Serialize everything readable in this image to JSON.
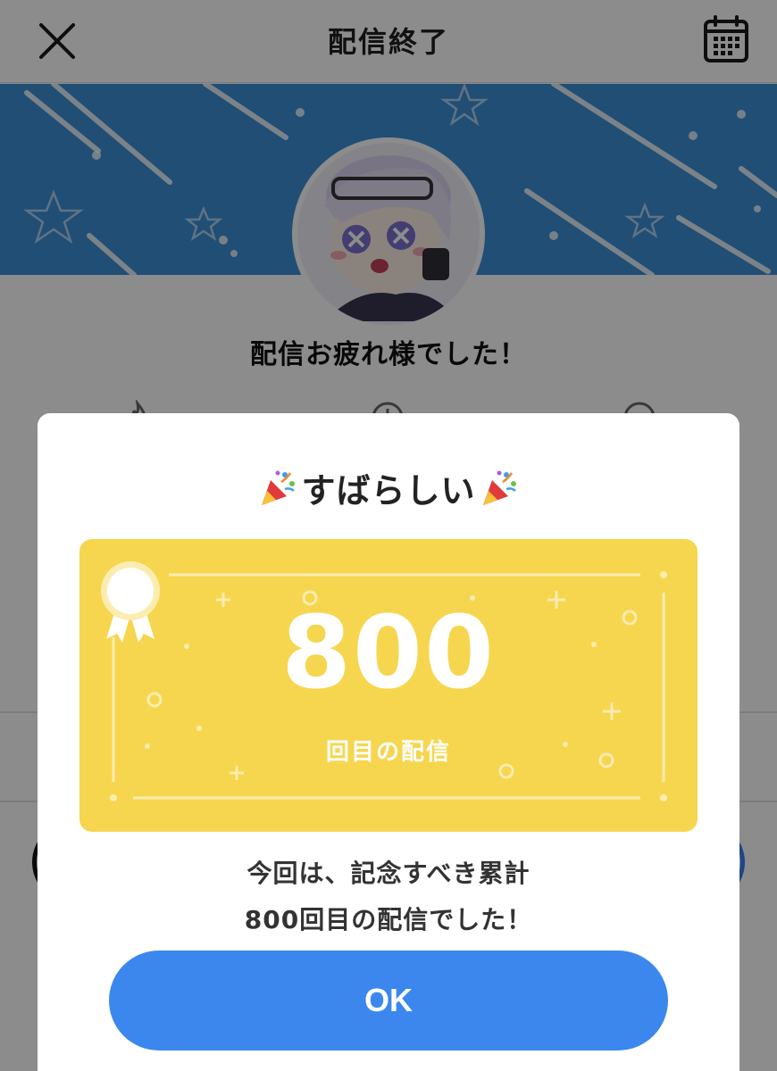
{
  "header": {
    "title": "配信終了",
    "close_icon": "close-icon",
    "calendar_icon": "calendar-icon"
  },
  "profile": {
    "thanks_text": "配信お疲れ様でした！"
  },
  "modal": {
    "title": "すばらしい",
    "title_emoji": "party-popper-icon",
    "count": "800",
    "count_caption": "回目の配信",
    "message_line1": "今回は、記念すべき累計",
    "message_line2": "800回目の配信でした！",
    "ok_label": "OK"
  },
  "colors": {
    "banner": "#3b8fd6",
    "card": "#f6d64f",
    "ok_button": "#3b87ee",
    "overlay": "rgba(0,0,0,0.45)"
  }
}
